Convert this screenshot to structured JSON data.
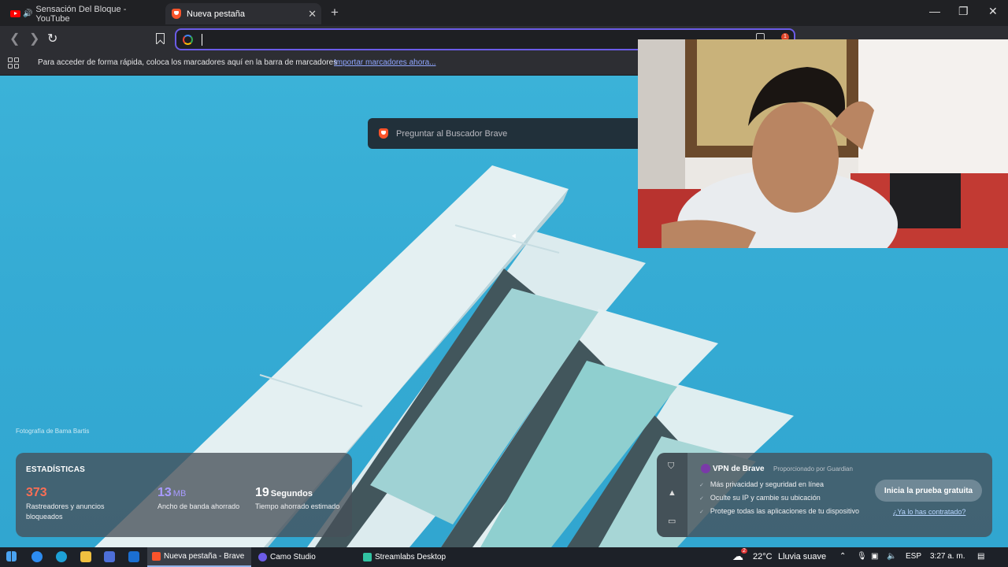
{
  "tabs": [
    {
      "title": "Sensación Del Bloque - YouTube",
      "icon": "youtube-icon",
      "audio": true
    },
    {
      "title": "Nueva pestaña",
      "icon": "brave-icon",
      "active": true
    }
  ],
  "address_bar": {
    "value": "",
    "placeholder": ""
  },
  "bookmarks_bar": {
    "message": "Para acceder de forma rápida, coloca los marcadores aquí en la barra de marcadores",
    "link": "Importar marcadores ahora..."
  },
  "search": {
    "placeholder": "Preguntar al Buscador Brave"
  },
  "shield_badge": "1",
  "photo_credit": "Fotografía de Bama Bartis",
  "stats": {
    "title": "ESTADÍSTICAS",
    "items": [
      {
        "value": "373",
        "unit": "",
        "label": "Rastreadores y anuncios bloqueados",
        "color": "#fb6e55"
      },
      {
        "value": "13",
        "unit": "MB",
        "label": "Ancho de banda ahorrado",
        "color": "#a89bff"
      },
      {
        "value": "19",
        "unit": "Segundos",
        "label": "Tiempo ahorrado estimado",
        "color": "#ffffff"
      }
    ]
  },
  "vpn": {
    "title": "VPN de Brave",
    "provider": "Proporcionado por  Guardian",
    "features": [
      "Más privacidad y seguridad en línea",
      "Oculte su IP y cambie su ubicación",
      "Protege todas las aplicaciones de tu dispositivo"
    ],
    "button": "Inicia la prueba gratuita",
    "link": "¿Ya lo has contratado?"
  },
  "taskbar": {
    "apps": [
      {
        "label": "Nueva pestaña - Brave",
        "active": true,
        "color": "#fb542b"
      },
      {
        "label": "Camo Studio",
        "active": false,
        "color": "#6b5ce7"
      },
      {
        "label": "Streamlabs Desktop",
        "active": false,
        "color": "#31c3a2"
      }
    ],
    "weather": {
      "temp": "22°C",
      "condition": "Lluvia suave",
      "badge": "2"
    },
    "language": "ESP",
    "time": "3:27 a. m."
  }
}
